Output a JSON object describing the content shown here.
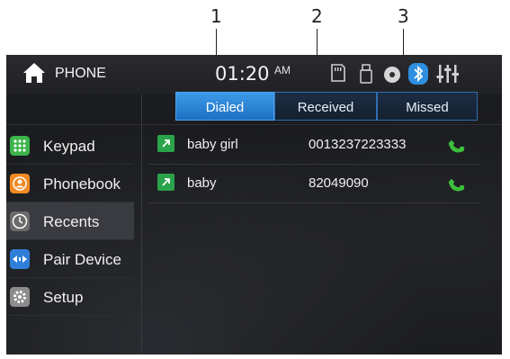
{
  "callouts": [
    "1",
    "2",
    "3"
  ],
  "status_bar": {
    "title": "PHONE",
    "time": "01:20",
    "ampm": "AM"
  },
  "tabs": [
    {
      "label": "Dialed",
      "active": true
    },
    {
      "label": "Received",
      "active": false
    },
    {
      "label": "Missed",
      "active": false
    }
  ],
  "sidebar": {
    "items": [
      {
        "label": "Keypad",
        "icon": "keypad-icon",
        "color": "#3cb54a"
      },
      {
        "label": "Phonebook",
        "icon": "contact-icon",
        "color": "#f08a24"
      },
      {
        "label": "Recents",
        "icon": "clock-icon",
        "color": "#7a7a7a"
      },
      {
        "label": "Pair Device",
        "icon": "bluetooth-pair-icon",
        "color": "#2f7fd8"
      },
      {
        "label": "Setup",
        "icon": "gear-icon",
        "color": "#8c8c8c"
      }
    ]
  },
  "calls": [
    {
      "name": "baby girl",
      "number": "0013237223333"
    },
    {
      "name": "baby",
      "number": "82049090"
    }
  ],
  "colors": {
    "accent": "#2f8fe0",
    "call_green": "#2aa34a",
    "background": "#1b1c1f"
  }
}
